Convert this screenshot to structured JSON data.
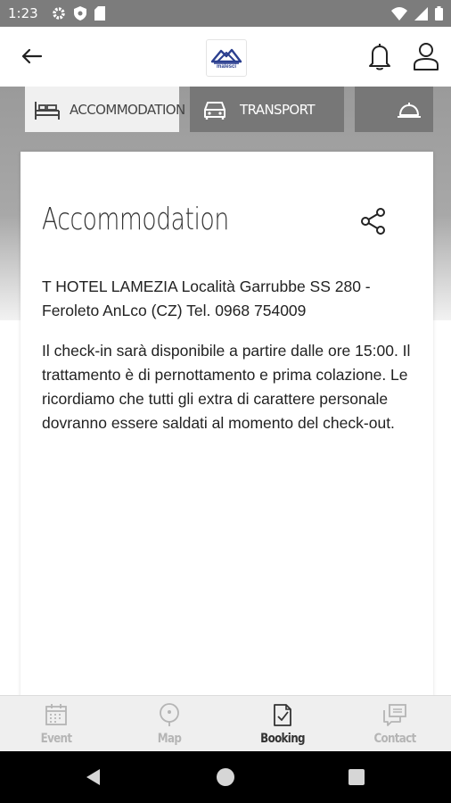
{
  "status_bar": {
    "time": "1:23",
    "left_icons": [
      "gear-icon",
      "shield-icon",
      "sim-card-icon"
    ],
    "right_icons": [
      "wifi-icon",
      "cellular-signal-icon",
      "battery-icon"
    ]
  },
  "app_bar": {
    "logo_text": "malesci"
  },
  "tabs": [
    {
      "label": "ACCOMMODATION",
      "icon": "bed-icon",
      "selected": true
    },
    {
      "label": "TRANSPORT",
      "icon": "car-icon",
      "selected": false
    },
    {
      "label": "",
      "icon": "service-bell-icon",
      "selected": false
    }
  ],
  "card": {
    "title": "Accommodation",
    "address": "T HOTEL LAMEZIA Località Garrubbe SS 280 - Feroleto AnLco (CZ) Tel. 0968 754009",
    "info": "Il check-in sarà disponibile a partire dalle ore 15:00. Il trattamento è di pernottamento e prima colazione. Le ricordiamo che tutti gli extra di carattere personale dovranno essere saldati al momento del check-out."
  },
  "bottom_nav": [
    {
      "label": "Event",
      "icon": "calendar-icon",
      "active": false
    },
    {
      "label": "Map",
      "icon": "map-pin-icon",
      "active": false
    },
    {
      "label": "Booking",
      "icon": "booking-document-icon",
      "active": true
    },
    {
      "label": "Contact",
      "icon": "chat-bubbles-icon",
      "active": false
    }
  ],
  "colors": {
    "status_bar": "#7c7c7c",
    "tab_selected": "#f0f0f0",
    "tab_unselected": "#777777",
    "logo_blue": "#2b3f8f"
  }
}
